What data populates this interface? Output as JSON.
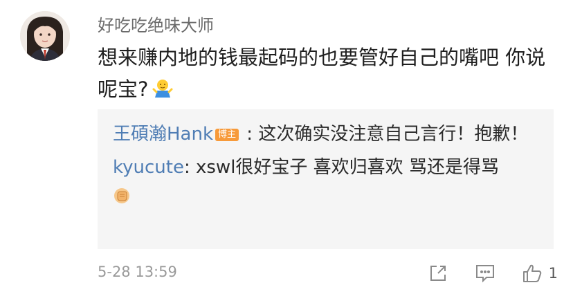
{
  "comment": {
    "username": "好吃吃绝味大师",
    "text": "想来赚内地的钱最起码的也要管好自己的嘴吧 你说呢宝?",
    "emoji": "shrug-emoji"
  },
  "replies": [
    {
      "name": "王碩瀚Hank",
      "badge": "博主",
      "separator": " : ",
      "text": "这次确实没注意自己言行！抱歉！"
    },
    {
      "name": "kyucute",
      "separator": ": ",
      "text": "xswl很好宝子 喜欢归喜欢 骂还是得骂",
      "emoji": "fist-emoji"
    }
  ],
  "footer": {
    "timestamp": "5-28 13:59",
    "like_count": "1"
  },
  "colors": {
    "link_blue": "#4f7db4",
    "badge_orange": "#f79a3a",
    "reply_bg": "#f5f5f5"
  },
  "icons": [
    "share-icon",
    "comment-icon",
    "like-icon"
  ]
}
